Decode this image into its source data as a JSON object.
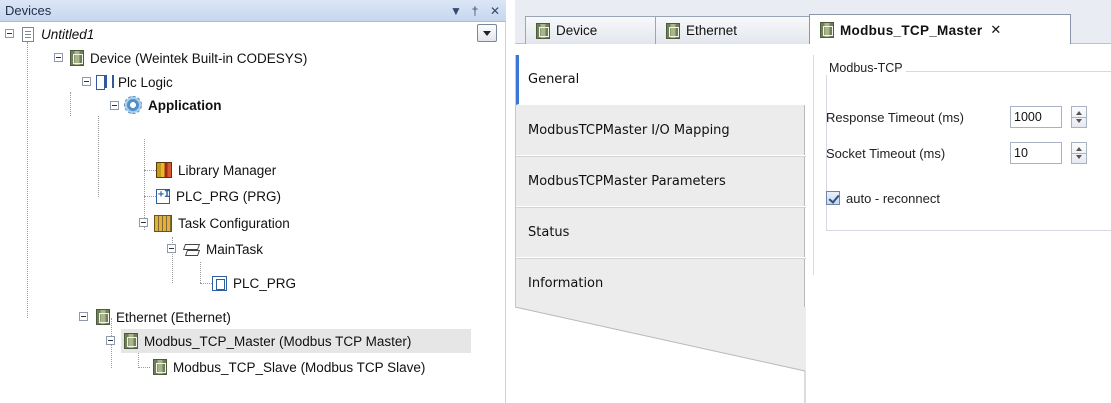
{
  "devices_panel": {
    "title": "Devices",
    "controls": {
      "menu_glyph": "▼",
      "pin_glyph": "†",
      "close_glyph": "✕"
    },
    "tree": [
      {
        "label": "Untitled1",
        "icon": "project-icon",
        "style": "italic"
      },
      {
        "label": "Device (Weintek Built-in CODESYS)",
        "icon": "device-icon"
      },
      {
        "label": "Plc Logic",
        "icon": "plc-logic-icon"
      },
      {
        "label": "Application",
        "icon": "application-gear-icon",
        "style": "bold"
      },
      {
        "label": "Library Manager",
        "icon": "library-icon"
      },
      {
        "label": "PLC_PRG (PRG)",
        "icon": "program-icon"
      },
      {
        "label": "Task Configuration",
        "icon": "task-config-icon"
      },
      {
        "label": "MainTask",
        "icon": "main-task-icon"
      },
      {
        "label": "PLC_PRG",
        "icon": "program-call-icon"
      },
      {
        "label": "Ethernet (Ethernet)",
        "icon": "device-icon"
      },
      {
        "label": "Modbus_TCP_Master (Modbus TCP Master)",
        "icon": "device-icon",
        "selected": true
      },
      {
        "label": "Modbus_TCP_Slave (Modbus TCP Slave)",
        "icon": "device-icon"
      }
    ]
  },
  "editor": {
    "tabs": [
      {
        "label": "Device",
        "icon": "device-icon"
      },
      {
        "label": "Ethernet",
        "icon": "device-icon"
      },
      {
        "label": "Modbus_TCP_Master",
        "icon": "device-icon",
        "active": true,
        "close_glyph": "✕"
      }
    ],
    "side_tabs": [
      {
        "label": "General",
        "active": true
      },
      {
        "label": "ModbusTCPMaster I/O Mapping"
      },
      {
        "label": "ModbusTCPMaster Parameters"
      },
      {
        "label": "Status"
      },
      {
        "label": "Information"
      }
    ],
    "general": {
      "group_title": "Modbus-TCP",
      "response_timeout": {
        "label": "Response  Timeout (ms)",
        "value": "1000"
      },
      "socket_timeout": {
        "label": "Socket Timeout (ms)",
        "value": "10"
      },
      "auto_reconnect": {
        "label": "auto - reconnect",
        "checked": true
      }
    }
  },
  "colors": {
    "header_gradient_top": "#dbe6f6",
    "header_gradient_bottom": "#c7d7ee",
    "accent": "#3b78d8",
    "selected_row": "#e6e6e6"
  }
}
